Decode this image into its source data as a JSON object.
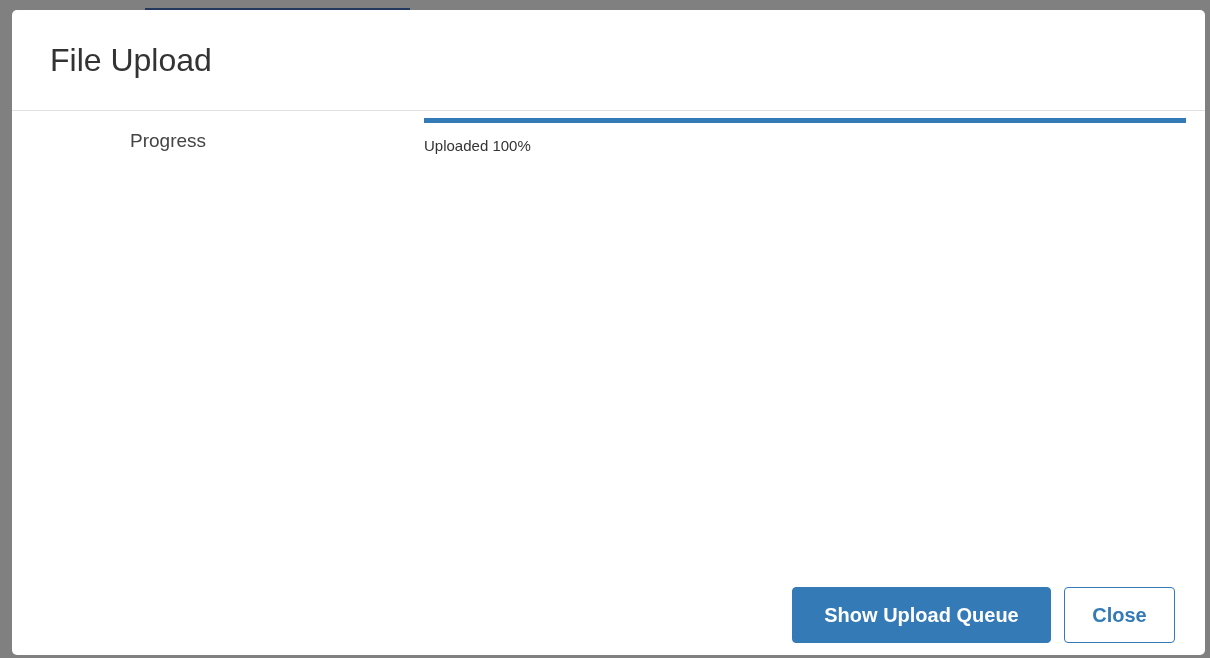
{
  "dialog": {
    "title": "File Upload",
    "progress": {
      "label": "Progress",
      "level": 1,
      "status": "Uploaded 100%"
    },
    "buttons": [
      {
        "label": "Show Upload Queue",
        "kind": "primary"
      },
      {
        "label": "Close",
        "kind": "secondary"
      }
    ]
  }
}
